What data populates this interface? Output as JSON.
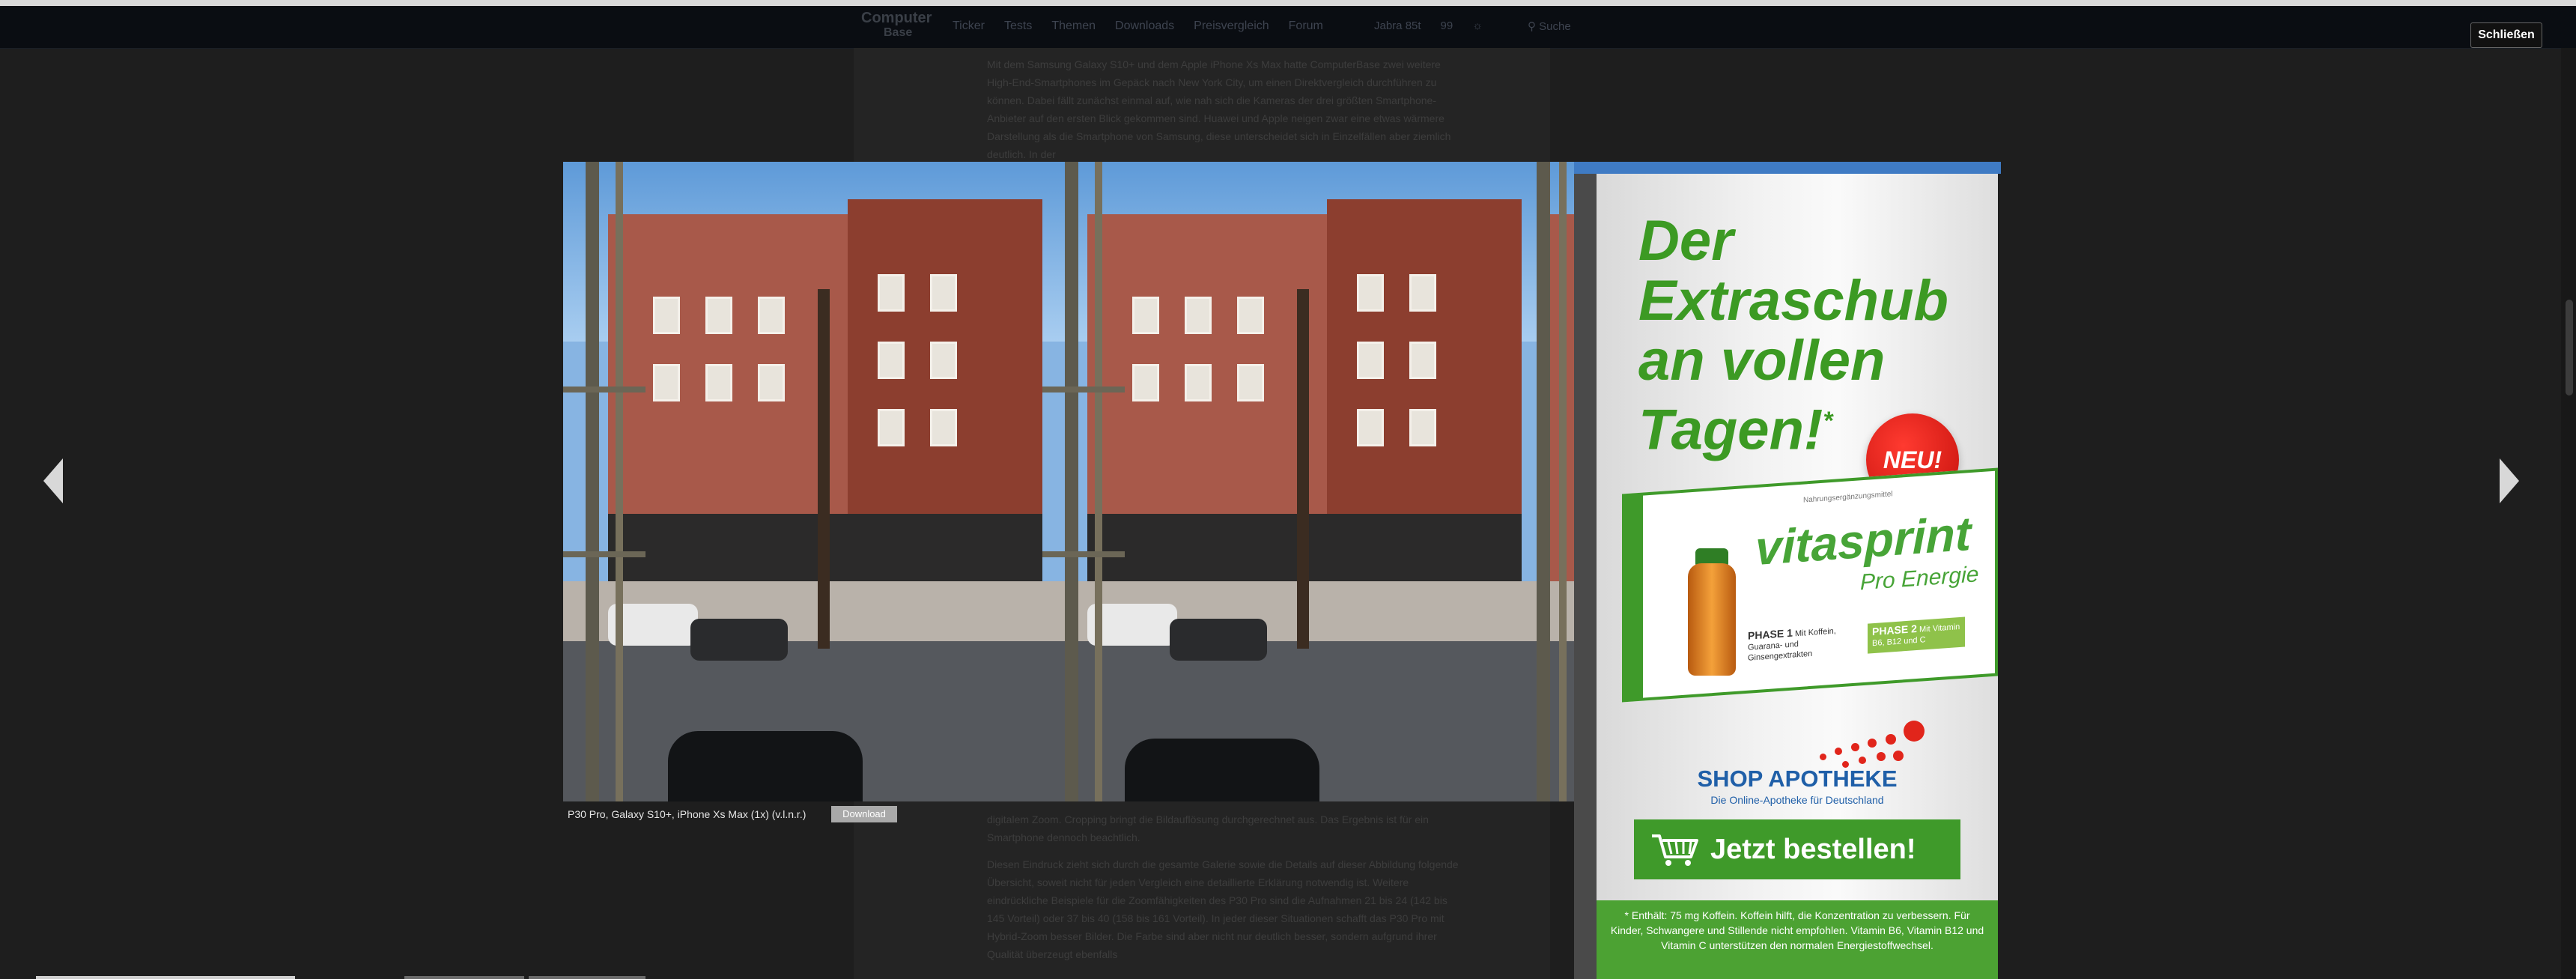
{
  "site": {
    "logo_line1": "Computer",
    "logo_line2": "Base",
    "nav": [
      "Ticker",
      "Tests",
      "Themen",
      "Downloads",
      "Preisvergleich",
      "Forum"
    ],
    "forum_count": "99",
    "tools": [
      "Jabra 85t",
      "99",
      "☼"
    ],
    "search_label": "Suche"
  },
  "lightbox": {
    "close_label": "Schließen",
    "caption": "P30 Pro, Galaxy S10+, iPhone Xs Max (1x) (v.l.n.r.)",
    "download_label": "Download"
  },
  "article": {
    "paragraph1": "Mit dem Samsung Galaxy S10+ und dem Apple iPhone Xs Max hatte ComputerBase zwei weitere High-End-Smartphones im Gepäck nach New York City, um einen Direktvergleich durchführen zu können. Dabei fällt zunächst einmal auf, wie nah sich die Kameras der drei größten Smartphone-Anbieter auf den ersten Blick gekommen sind. Huawei und Apple neigen zwar eine etwas wärmere Darstellung als die Smartphone von Samsung, diese unterscheidet sich in Einzelfällen aber ziemlich deutlich. In der",
    "paragraph2": "digitalem Zoom. Cropping bringt die Bildauflösung durchgerechnet aus. Das Ergebnis ist für ein Smartphone dennoch beachtlich.",
    "paragraph3": "Diesen Eindruck zieht sich durch die gesamte Galerie sowie die Details auf dieser Abbildung folgende Übersicht, soweit nicht für jeden Vergleich eine detaillierte Erklärung notwendig ist. Weitere eindrückliche Beispiele für die Zoomfähigkeiten des P30 Pro sind die Aufnahmen 21 bis 24 (142 bis 145 Vorteil) oder 37 bis 40 (158 bis 161 Vorteil). In jeder dieser Situationen schafft das P30 Pro mit Hybrid-Zoom besser Bilder. Die Farbe sind aber nicht nur deutlich besser, sondern aufgrund ihrer Qualität überzeugt ebenfalls"
  },
  "ad": {
    "headline": [
      "Der",
      "Extraschub",
      "an vollen",
      "Tagen!"
    ],
    "headline_mark": "*",
    "badge": "NEU!",
    "pack_note": "Nahrungsergänzungsmittel",
    "product": "vitasprint",
    "product_sub": "Pro Energie",
    "phase1_title": "PHASE 1",
    "phase1_text": "Mit Koffein, Guarana- und Ginsengextrakten",
    "phase2_title": "PHASE 2",
    "phase2_text": "Mit Vitamin B6, B12 und C",
    "shop_name": "SHOP APOTHEKE",
    "shop_sub": "Die Online-Apotheke für Deutschland",
    "cta": "Jetzt bestellen!",
    "footnote": "* Enthält: 75 mg Koffein. Koffein hilft, die Konzentration zu verbessern. Für Kinder, Schwangere und Stillende nicht empfohlen. Vitamin B6, Vitamin B12 und Vitamin C unterstützen den normalen Energiestoffwechsel."
  },
  "icons": [
    "chevron-left-icon",
    "chevron-right-icon",
    "shopping-cart-icon",
    "search-icon"
  ],
  "colors": {
    "accent_green": "#3f9a2a",
    "shop_blue": "#1f5fa8",
    "badge_red": "#e1251b",
    "overlay": "#1e1e1e"
  }
}
